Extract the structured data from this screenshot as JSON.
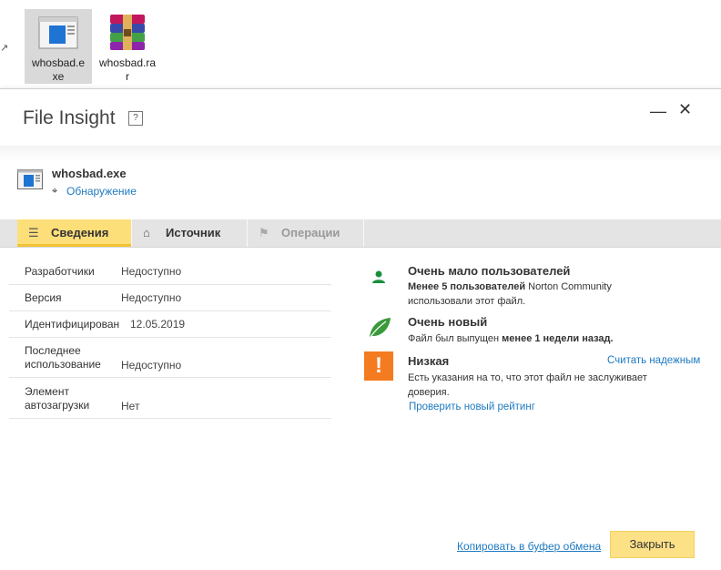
{
  "desktop": {
    "files": [
      {
        "label_line1": "whosbad.e",
        "label_line2": "xe",
        "icon": "exe-file-icon"
      },
      {
        "label_line1": "whosbad.ra",
        "label_line2": "r",
        "icon": "rar-archive-icon"
      }
    ]
  },
  "dialog": {
    "title": "File Insight",
    "help_label": "?",
    "minimize_label": "—",
    "close_label": "✕"
  },
  "file": {
    "name": "whosbad.exe",
    "detection_link": "Обнаружение"
  },
  "tabs": [
    {
      "label": "Сведения",
      "icon": "list-icon"
    },
    {
      "label": "Источник",
      "icon": "home-icon"
    },
    {
      "label": "Операции",
      "icon": "flag-icon"
    }
  ],
  "details": [
    {
      "key": "Разработчики",
      "value": "Недоступно"
    },
    {
      "key": "Версия",
      "value": "Недоступно"
    },
    {
      "key": "Идентифицирован",
      "value": "12.05.2019"
    },
    {
      "key_line1": "Последнее",
      "key_line2": "использование",
      "value": "Недоступно"
    },
    {
      "key_line1": "Элемент",
      "key_line2": "автозагрузки",
      "value": "Нет"
    }
  ],
  "info": {
    "users": {
      "title": "Очень мало пользователей",
      "text_bold": "Менее 5 пользователей",
      "text_rest": " Norton Community",
      "text_line2": "использовали этот файл.",
      "icon": "user-icon"
    },
    "age": {
      "title": "Очень новый",
      "text_start": "Файл был выпущен ",
      "text_bold": "менее 1 недели назад.",
      "icon": "leaf-icon"
    },
    "trust": {
      "title": "Низкая",
      "trust_link": "Считать надежным",
      "text_line1": "Есть указания на то, что этот файл не заслуживает",
      "text_line2": "доверия.",
      "recheck_link": "Проверить новый рейтинг",
      "icon_glyph": "!",
      "icon": "warning-icon"
    }
  },
  "footer": {
    "copy_link": "Копировать в буфер обмена",
    "close_button": "Закрыть"
  },
  "colors": {
    "accent_yellow": "#fddf7a",
    "link_blue": "#1e7ac0",
    "warning_orange": "#f47b20",
    "user_green": "#1a8f3c",
    "leaf_green": "#3a9a3a"
  }
}
